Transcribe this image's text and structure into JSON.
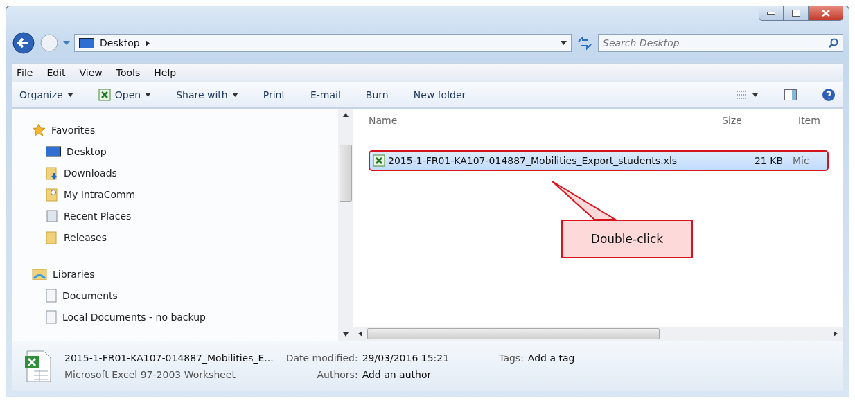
{
  "address": {
    "location": "Desktop",
    "search_placeholder": "Search Desktop"
  },
  "menu": [
    "File",
    "Edit",
    "View",
    "Tools",
    "Help"
  ],
  "toolbar": [
    {
      "label": "Organize",
      "dropdown": true,
      "kind": "plain"
    },
    {
      "label": "Open",
      "dropdown": true,
      "kind": "excel"
    },
    {
      "label": "Share with",
      "dropdown": true,
      "kind": "plain"
    },
    {
      "label": "Print",
      "dropdown": false,
      "kind": "plain"
    },
    {
      "label": "E-mail",
      "dropdown": false,
      "kind": "plain"
    },
    {
      "label": "Burn",
      "dropdown": false,
      "kind": "plain"
    },
    {
      "label": "New folder",
      "dropdown": false,
      "kind": "plain"
    }
  ],
  "sidebar": {
    "groups": [
      {
        "label": "Favorites",
        "kind": "favorites",
        "children": [
          {
            "label": "Desktop",
            "kind": "desktop"
          },
          {
            "label": "Downloads",
            "kind": "downloads"
          },
          {
            "label": "My IntraComm",
            "kind": "shortcut"
          },
          {
            "label": "Recent Places",
            "kind": "recent"
          },
          {
            "label": "Releases",
            "kind": "folder"
          }
        ]
      },
      {
        "label": "Libraries",
        "kind": "libraries",
        "children": [
          {
            "label": "Documents",
            "kind": "document"
          },
          {
            "label": "Local Documents - no backup",
            "kind": "document"
          }
        ]
      }
    ]
  },
  "table": {
    "columns": [
      "Name",
      "Size",
      "Item"
    ],
    "rows": [
      {
        "name": "2015-1-FR01-KA107-014887_Mobilities_Export_students.xls",
        "size": "21 KB",
        "item": "Mic",
        "selected": true
      }
    ]
  },
  "callout": {
    "text": "Double-click"
  },
  "details": {
    "name": "2015-1-FR01-KA107-014887_Mobilities_E...",
    "type": "Microsoft Excel 97-2003 Worksheet",
    "fields": [
      {
        "label": "Date modified:",
        "value": "29/03/2016 15:21"
      },
      {
        "label": "Authors:",
        "value": "Add an author"
      },
      {
        "label": "Tags:",
        "value": "Add a tag"
      }
    ]
  }
}
